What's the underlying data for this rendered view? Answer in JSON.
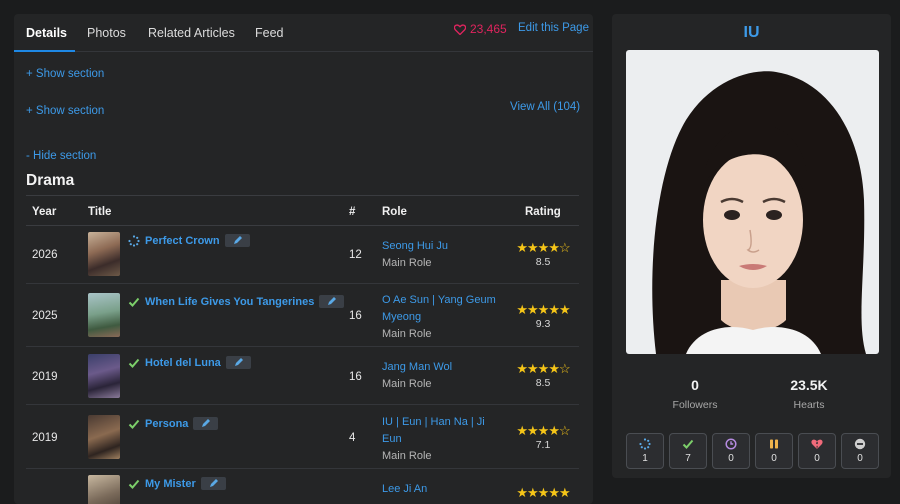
{
  "tabs": [
    {
      "label": "Details"
    },
    {
      "label": "Photos"
    },
    {
      "label": "Related Articles"
    },
    {
      "label": "Feed"
    }
  ],
  "hearts_count": "23,465",
  "edit_page_label": "Edit this Page",
  "show_section_1": "+ Show section",
  "show_section_2": "+ Show section",
  "view_all_label": "View All (104)",
  "hide_section": "- Hide section",
  "section_title": "Drama",
  "table": {
    "headers": {
      "year": "Year",
      "title": "Title",
      "num": "#",
      "role": "Role",
      "rating": "Rating"
    },
    "rows": [
      {
        "year": "2026",
        "title": "Perfect Crown",
        "status": "loading-icon",
        "episodes": "12",
        "character": "Seong Hui Ju",
        "role_type": "Main Role",
        "stars": "★★★★☆",
        "score": "8.5",
        "rating_value": 8.5
      },
      {
        "year": "2025",
        "title": "When Life Gives You Tangerines",
        "status": "check-icon",
        "episodes": "16",
        "character": "O Ae Sun | Yang Geum Myeong",
        "role_type": "Main Role",
        "stars": "★★★★★",
        "score": "9.3",
        "rating_value": 9.3
      },
      {
        "year": "2019",
        "title": "Hotel del Luna",
        "status": "check-icon",
        "episodes": "16",
        "character": "Jang Man Wol",
        "role_type": "Main Role",
        "stars": "★★★★☆",
        "score": "8.5",
        "rating_value": 8.5
      },
      {
        "year": "2019",
        "title": "Persona",
        "status": "check-icon",
        "episodes": "4",
        "character": "IU | Eun | Han Na | Ji Eun",
        "role_type": "Main Role",
        "stars": "★★★★☆",
        "score": "7.1",
        "rating_value": 7.1
      },
      {
        "year": "",
        "title": "My Mister",
        "status": "check-icon",
        "episodes": "",
        "character": "Lee Ji An",
        "role_type": "",
        "stars": "★★★★★",
        "score": "",
        "rating_value": null
      }
    ]
  },
  "profile": {
    "name": "IU",
    "followers_value": "0",
    "followers_label": "Followers",
    "hearts_value": "23.5K",
    "hearts_label": "Hearts",
    "status_counts": [
      {
        "icon": "loading-icon",
        "count": "1",
        "color": "#5aa9e6"
      },
      {
        "icon": "check-icon",
        "count": "7",
        "color": "#7ccf6a"
      },
      {
        "icon": "clock-icon",
        "count": "0",
        "color": "#b58be0"
      },
      {
        "icon": "pause-icon",
        "count": "0",
        "color": "#f0b44c"
      },
      {
        "icon": "broken-heart-icon",
        "count": "0",
        "color": "#f06a7a"
      },
      {
        "icon": "minus-icon",
        "count": "0",
        "color": "#cfcfcf"
      }
    ]
  },
  "colors": {
    "accent": "#3d9ae8",
    "heart": "#e0245e",
    "star": "#f5c518",
    "check": "#7ccf6a"
  }
}
